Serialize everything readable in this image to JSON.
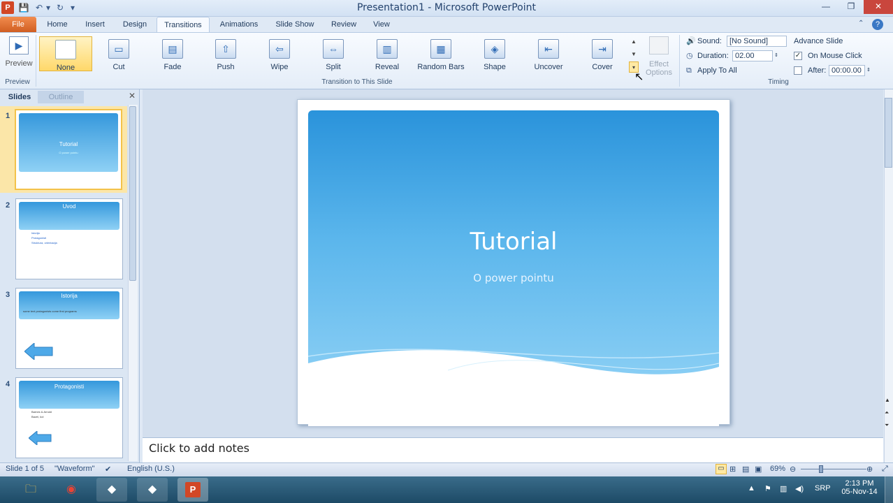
{
  "window": {
    "title": "Presentation1 - Microsoft PowerPoint",
    "app_icon": "P"
  },
  "qat": {
    "save": "💾",
    "undo": "↶",
    "redo": "↻",
    "customize": "▾"
  },
  "tabs": [
    "File",
    "Home",
    "Insert",
    "Design",
    "Transitions",
    "Animations",
    "Slide Show",
    "Review",
    "View"
  ],
  "ribbon": {
    "preview": {
      "label": "Preview",
      "group": "Preview"
    },
    "transitions": [
      {
        "label": "None",
        "icon": "blank-icon"
      },
      {
        "label": "Cut",
        "icon": "cut-transition-icon"
      },
      {
        "label": "Fade",
        "icon": "fade-transition-icon"
      },
      {
        "label": "Push",
        "icon": "push-transition-icon"
      },
      {
        "label": "Wipe",
        "icon": "wipe-transition-icon"
      },
      {
        "label": "Split",
        "icon": "split-transition-icon"
      },
      {
        "label": "Reveal",
        "icon": "reveal-transition-icon"
      },
      {
        "label": "Random Bars",
        "icon": "random-bars-icon"
      },
      {
        "label": "Shape",
        "icon": "shape-transition-icon"
      },
      {
        "label": "Uncover",
        "icon": "uncover-transition-icon"
      },
      {
        "label": "Cover",
        "icon": "cover-transition-icon"
      }
    ],
    "transitions_group": "Transition to This Slide",
    "effect_options": {
      "line1": "Effect",
      "line2": "Options"
    },
    "timing": {
      "sound_label": "Sound:",
      "sound_value": "[No Sound]",
      "duration_label": "Duration:",
      "duration_value": "02.00",
      "apply_all": "Apply To All",
      "advance_title": "Advance Slide",
      "on_mouse_click": "On Mouse Click",
      "on_mouse_click_checked": true,
      "after_label": "After:",
      "after_value": "00:00.00",
      "after_checked": false,
      "group": "Timing"
    }
  },
  "slides_panel": {
    "tab_slides": "Slides",
    "tab_outline": "Outline",
    "thumbs": [
      {
        "num": "1",
        "title": "Tutorial",
        "subtitle": "O power pointu"
      },
      {
        "num": "2",
        "title": "Uvod",
        "bullets": [
          "Istorija",
          "Protagonisti",
          "Struktura, orientacija"
        ]
      },
      {
        "num": "3",
        "title": "Istorija",
        "text": "some text protagonists come first programs"
      },
      {
        "num": "4",
        "title": "Protagonisti",
        "bullets": [
          "Barnes & Arnold",
          "Bazel, kol"
        ]
      }
    ]
  },
  "slide": {
    "title": "Tutorial",
    "subtitle": "O power pointu"
  },
  "notes": {
    "placeholder": "Click to add notes"
  },
  "status": {
    "slide_info": "Slide 1 of 5",
    "theme": "\"Waveform\"",
    "language": "English (U.S.)",
    "zoom": "69%"
  },
  "taskbar": {
    "lang": "SRP",
    "time": "2:13 PM",
    "date": "05-Nov-14"
  }
}
